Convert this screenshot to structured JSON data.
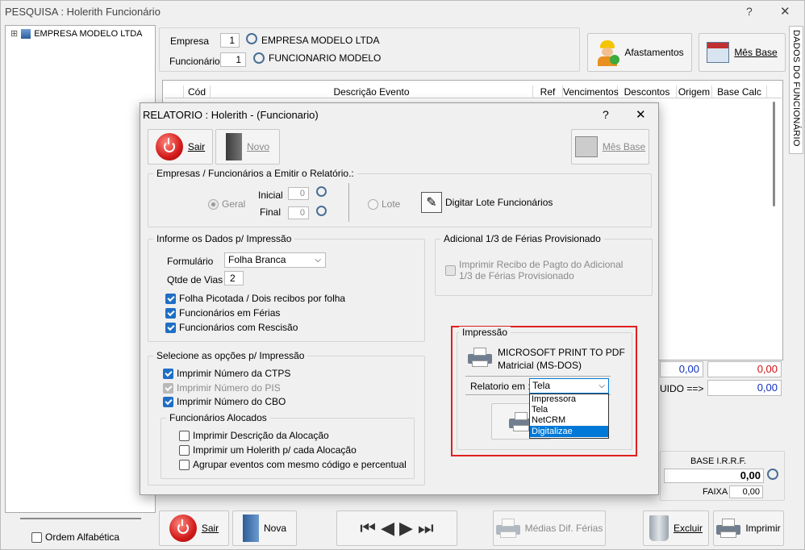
{
  "main_window": {
    "title": "PESQUISA : Holerith Funcionário",
    "help": "?",
    "close": "✕",
    "tree_item": "EMPRESA MODELO LTDA",
    "tree_expander": "⊞",
    "ordem_alfabetica": "Ordem Alfabética",
    "empresa_label": "Empresa",
    "empresa_code": "1",
    "empresa_name": "EMPRESA MODELO LTDA",
    "funcionario_label": "Funcionário",
    "funcionario_code": "1",
    "funcionario_name": "FUNCIONARIO MODELO",
    "afastamentos": "Afastamentos",
    "mes_base": "Mês Base",
    "side_tab": "DADOS DO FUNCIONÁRIO",
    "columns": [
      "Cód",
      "Descrição Evento",
      "Ref",
      "Vencimentos",
      "Descontos",
      "Origem",
      "Base Calc"
    ],
    "total_venc": "0,00",
    "total_desc": "0,00",
    "liquido_label": "UIDO ==>",
    "liquido_value": "0,00",
    "base_irrf_label": "BASE I.R.R.F.",
    "base_irrf_value": "0,00",
    "faixa_label": "FAIXA",
    "faixa_value": "0,00",
    "bottom": {
      "sair": "Sair",
      "nova": "Nova",
      "medias": "Médias Dif. Férias",
      "excluir": "Excluir",
      "imprimir": "Imprimir"
    }
  },
  "dialog": {
    "title": "RELATORIO : Holerith - (Funcionario)",
    "help": "?",
    "close": "✕",
    "sair": "Sair",
    "novo": "Novo",
    "mes_base": "Mês Base",
    "group_emitir": "Empresas / Funcionários a Emitir o Relatório.:",
    "geral": "Geral",
    "inicial_label": "Inicial",
    "inicial_value": "0",
    "final_label": "Final",
    "final_value": "0",
    "lote": "Lote",
    "digitar_lote": "Digitar Lote Funcionários",
    "group_dados": "Informe os Dados p/ Impressão",
    "formulario_label": "Formulário",
    "formulario_value": "Folha Branca",
    "vias_label": "Qtde de Vias",
    "vias_value": "2",
    "folha_picotada": "Folha Picotada / Dois recibos por folha",
    "func_ferias": "Funcionários em Férias",
    "func_rescisao": "Funcionários com Rescisão",
    "group_adicional": "Adicional 1/3 de Férias Provisionado",
    "imprimir_recibo_l1": "Imprimir Recibo de Pagto do Adicional",
    "imprimir_recibo_l2": "1/3 de Férias Provisionado",
    "group_opcoes": "Selecione as opções p/ Impressão",
    "opt_ctps": "Imprimir Número da CTPS",
    "opt_pis": "Imprimir Número do PIS",
    "opt_cbo": "Imprimir Número do CBO",
    "group_alocados": "Funcionários Alocados",
    "opt_desc_aloc": "Imprimir Descrição da Alocação",
    "opt_holerith_aloc": "Imprimir um Holerith p/ cada Alocação",
    "opt_agrupar": "Agrupar eventos com mesmo código e percentual",
    "group_impressao": "Impressão",
    "printer_name": "MICROSOFT PRINT TO PDF",
    "printer_type": "Matricial (MS-DOS)",
    "relatorio_em_label": "Relatorio em :",
    "relatorio_em_value": "Tela",
    "options": [
      "Impressora",
      "Tela",
      "NetCRM",
      "Digitalizae"
    ],
    "highlight_color": "#e02020",
    "selected_color": "#0078d7"
  }
}
